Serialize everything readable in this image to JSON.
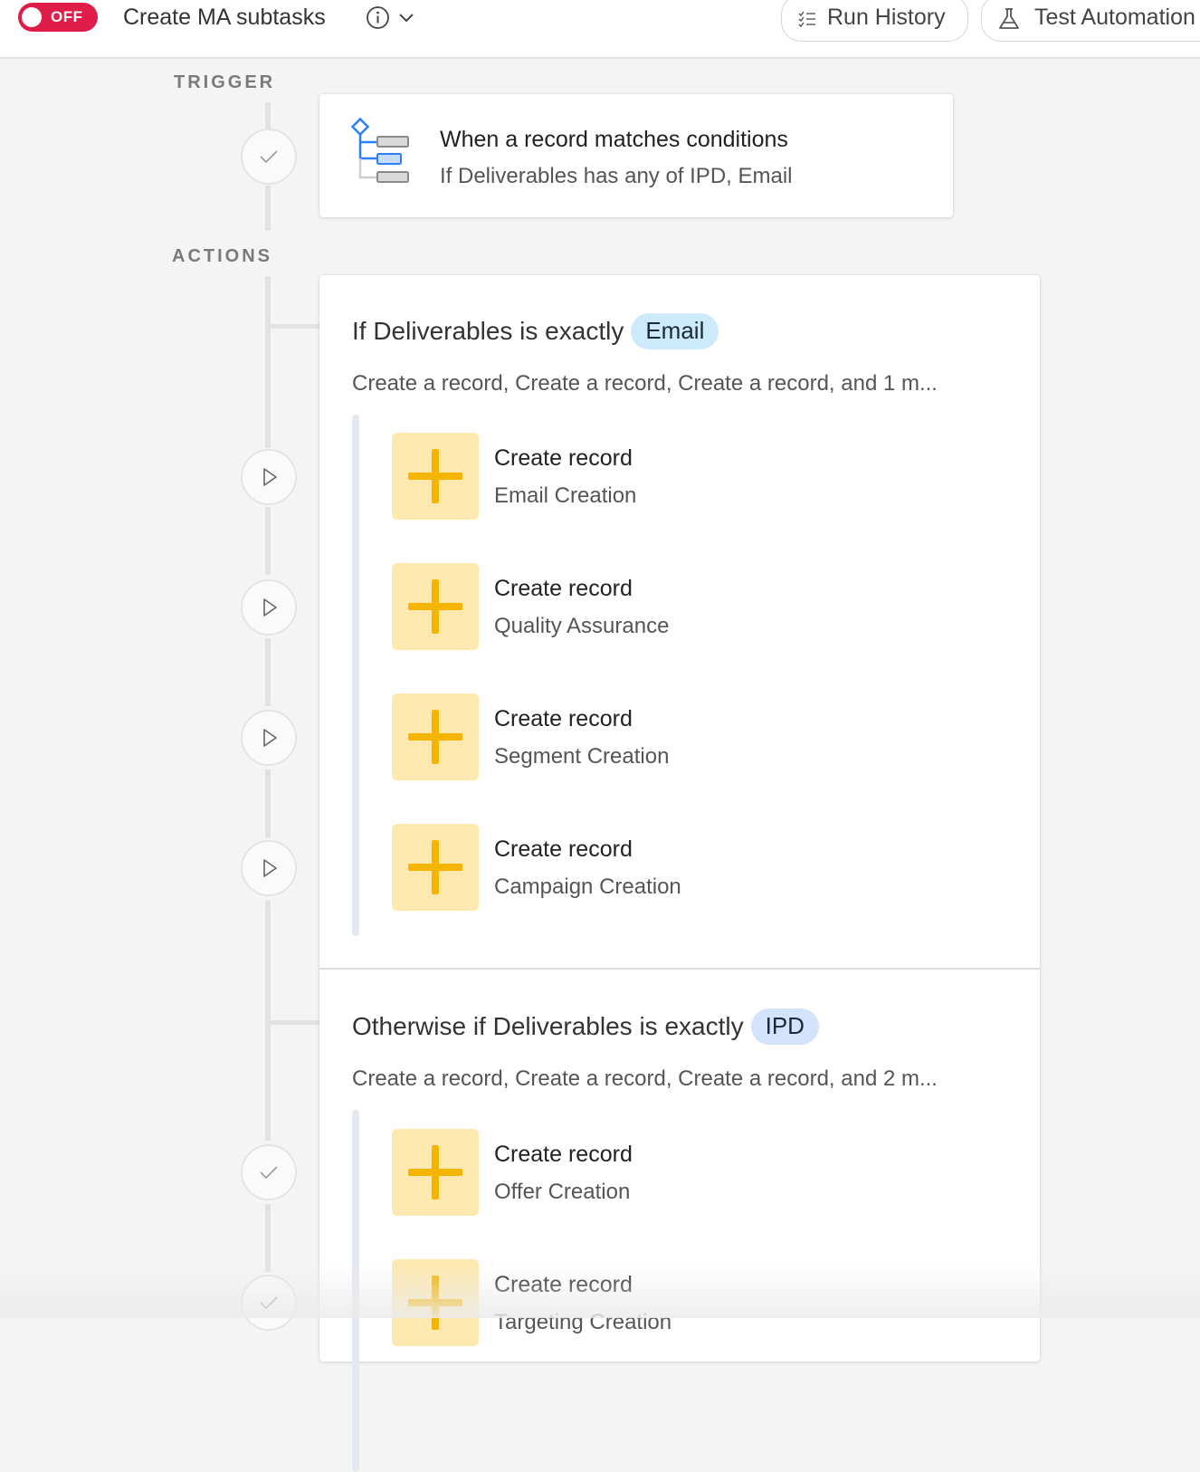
{
  "header": {
    "toggle_label": "OFF",
    "title": "Create MA subtasks",
    "run_history_label": "Run History",
    "test_automation_label": "Test Automation"
  },
  "timeline": {
    "trigger_label": "TRIGGER",
    "actions_label": "ACTIONS"
  },
  "trigger": {
    "title": "When a record matches conditions",
    "description": "If Deliverables has any of IPD, Email"
  },
  "branches": [
    {
      "title": "If Deliverables is exactly",
      "pill": "Email",
      "pill_color": "#cdeafb",
      "summary": "Create a record, Create a record, Create a record, and 1 m...",
      "actions": [
        {
          "title": "Create record",
          "subtitle": "Email Creation"
        },
        {
          "title": "Create record",
          "subtitle": "Quality Assurance"
        },
        {
          "title": "Create record",
          "subtitle": "Segment Creation"
        },
        {
          "title": "Create record",
          "subtitle": "Campaign Creation"
        }
      ]
    },
    {
      "title": "Otherwise if Deliverables is exactly",
      "pill": "IPD",
      "pill_color": "#d3e3fb",
      "summary": "Create a record, Create a record, Create a record, and 2 m...",
      "actions": [
        {
          "title": "Create record",
          "subtitle": "Offer Creation"
        },
        {
          "title": "Create record",
          "subtitle": "Targeting Creation"
        }
      ]
    }
  ],
  "colors": {
    "toggle_off": "#e01c48",
    "action_icon_bg": "#fde8b0",
    "action_icon_fg": "#f5b400",
    "trigger_icon_blue": "#2d7ff9"
  },
  "icons": {
    "trigger": "conditions-icon",
    "action": "plus-icon",
    "step_done": "check-icon",
    "step_play": "play-icon"
  }
}
